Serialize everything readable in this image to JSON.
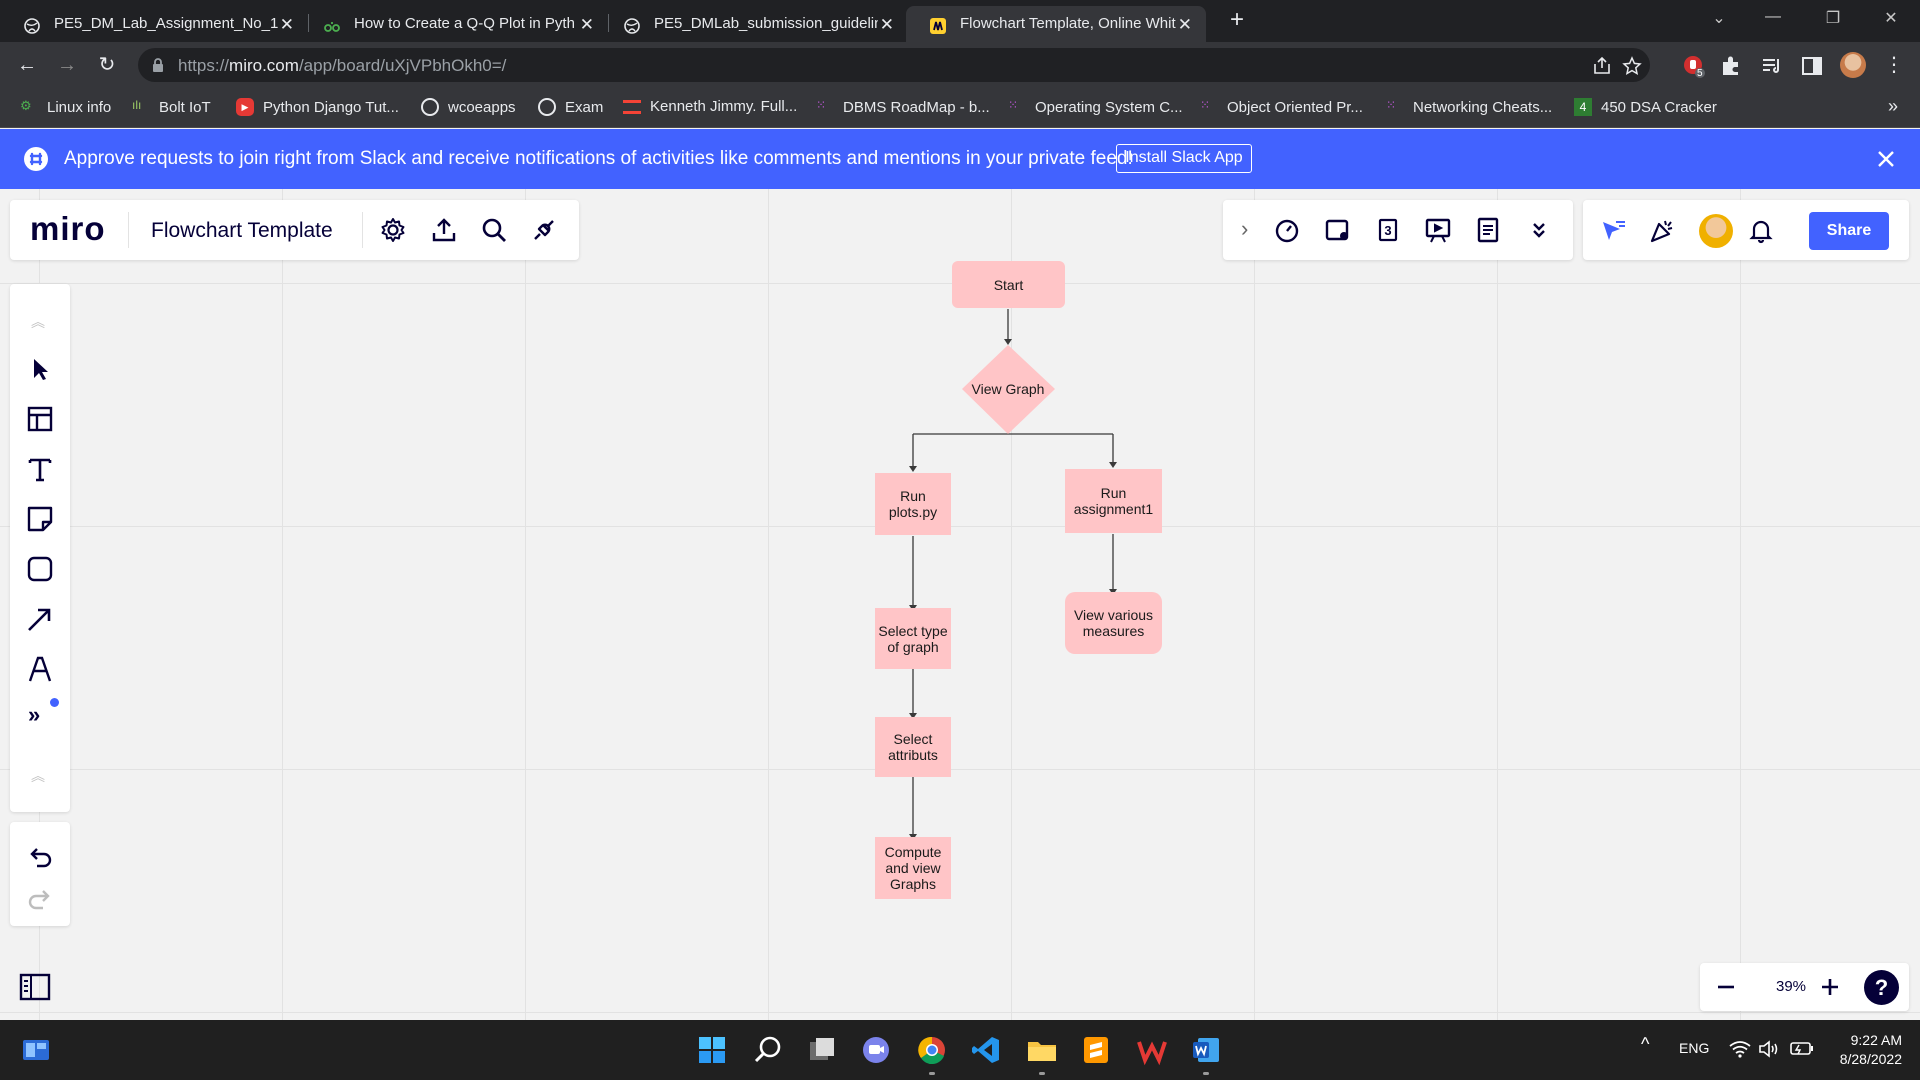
{
  "browser": {
    "tabs": [
      {
        "title": "PE5_DM_Lab_Assignment_No_1.p",
        "icon": "globe-icon",
        "active": false
      },
      {
        "title": "How to Create a Q-Q Plot in Pyth",
        "icon": "statology-icon",
        "active": false
      },
      {
        "title": "PE5_DMLab_submission_guidelin",
        "icon": "globe-icon",
        "active": false
      },
      {
        "title": "Flowchart Template, Online Whit",
        "icon": "miro-icon",
        "active": true
      }
    ],
    "url_prefix": "https://",
    "url_host": "miro.com",
    "url_path": "/app/board/uXjVPbhOkh0=/",
    "extension_badge": "5",
    "bookmarks": [
      {
        "label": "Linux info",
        "icon": "linux-icon"
      },
      {
        "label": "Bolt IoT",
        "icon": "bolt-icon"
      },
      {
        "label": "Python Django Tut...",
        "icon": "youtube-icon"
      },
      {
        "label": "wcoeapps",
        "icon": "globe-icon"
      },
      {
        "label": "Exam",
        "icon": "globe-icon"
      },
      {
        "label": "Kenneth Jimmy. Full...",
        "icon": "stack-icon"
      },
      {
        "label": "DBMS RoadMap - b...",
        "icon": "dots-icon"
      },
      {
        "label": "Operating System C...",
        "icon": "dots-icon"
      },
      {
        "label": "Object Oriented Pr...",
        "icon": "dots-icon"
      },
      {
        "label": "Networking Cheats...",
        "icon": "dots-icon"
      },
      {
        "label": "450 DSA Cracker",
        "icon": "four-icon"
      }
    ]
  },
  "banner": {
    "text": "Approve requests to join right from Slack and receive notifications of activities like comments and mentions in your private feed!",
    "button": "Install Slack App"
  },
  "miro": {
    "logo": "miro",
    "board_title": "Flowchart Template",
    "share_label": "Share",
    "zoom": "39%",
    "help": "?",
    "counter_icon_label": "3"
  },
  "flowchart": {
    "nodes": {
      "start": "Start",
      "view_graph": "View Graph",
      "run_plots": "Run plots.py",
      "run_assignment": "Run assignment1",
      "select_graph": "Select type of graph",
      "view_measures": "View various measures",
      "select_attributes": "Select attributs",
      "compute_graphs": "Compute  and  view Graphs"
    }
  },
  "taskbar": {
    "lang": "ENG",
    "time": "9:22 AM",
    "date": "8/28/2022"
  },
  "colors": {
    "miro_blue": "#4262ff",
    "node_pink": "#ffc5c7",
    "miro_dark": "#050038"
  }
}
